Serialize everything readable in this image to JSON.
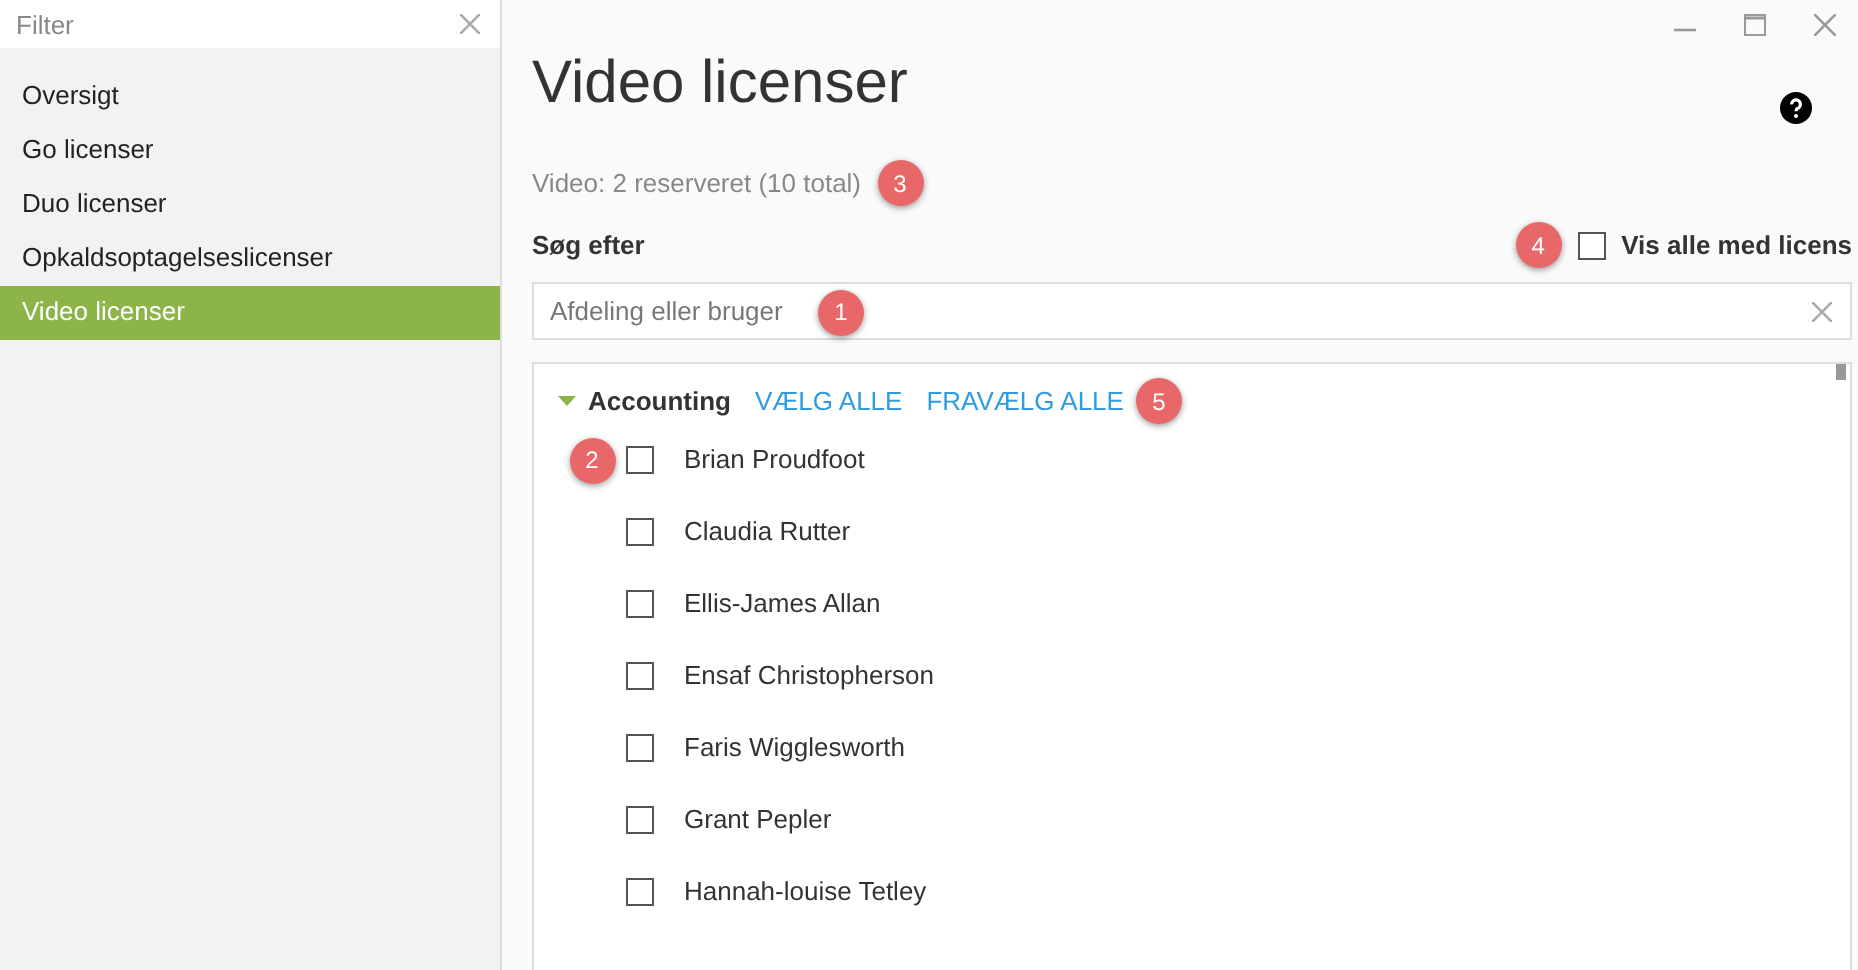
{
  "sidebar": {
    "filter": {
      "placeholder": "Filter"
    },
    "items": [
      {
        "label": "Oversigt",
        "selected": false
      },
      {
        "label": "Go licenser",
        "selected": false
      },
      {
        "label": "Duo licenser",
        "selected": false
      },
      {
        "label": "Opkaldsoptagelseslicenser",
        "selected": false
      },
      {
        "label": "Video licenser",
        "selected": true
      }
    ]
  },
  "page": {
    "title": "Video licenser",
    "summary": "Video: 2 reserveret (10 total)",
    "summary_callout": "3",
    "search_label": "Søg efter",
    "show_all": {
      "label": "Vis alle med licens",
      "checked": false,
      "callout": "4"
    },
    "search": {
      "placeholder": "Afdeling eller bruger",
      "callout": "1"
    }
  },
  "group": {
    "name": "Accounting",
    "expanded": true,
    "select_all": "VÆLG ALLE",
    "deselect_all": "FRAVÆLG ALLE",
    "callout": "5",
    "users": [
      {
        "name": "Brian Proudfoot",
        "checked": false,
        "callout": "2"
      },
      {
        "name": "Claudia Rutter",
        "checked": false
      },
      {
        "name": "Ellis-James Allan",
        "checked": false
      },
      {
        "name": "Ensaf Christopherson",
        "checked": false
      },
      {
        "name": "Faris Wigglesworth",
        "checked": false
      },
      {
        "name": "Grant Pepler",
        "checked": false
      },
      {
        "name": "Hannah-louise Tetley",
        "checked": false
      }
    ]
  }
}
